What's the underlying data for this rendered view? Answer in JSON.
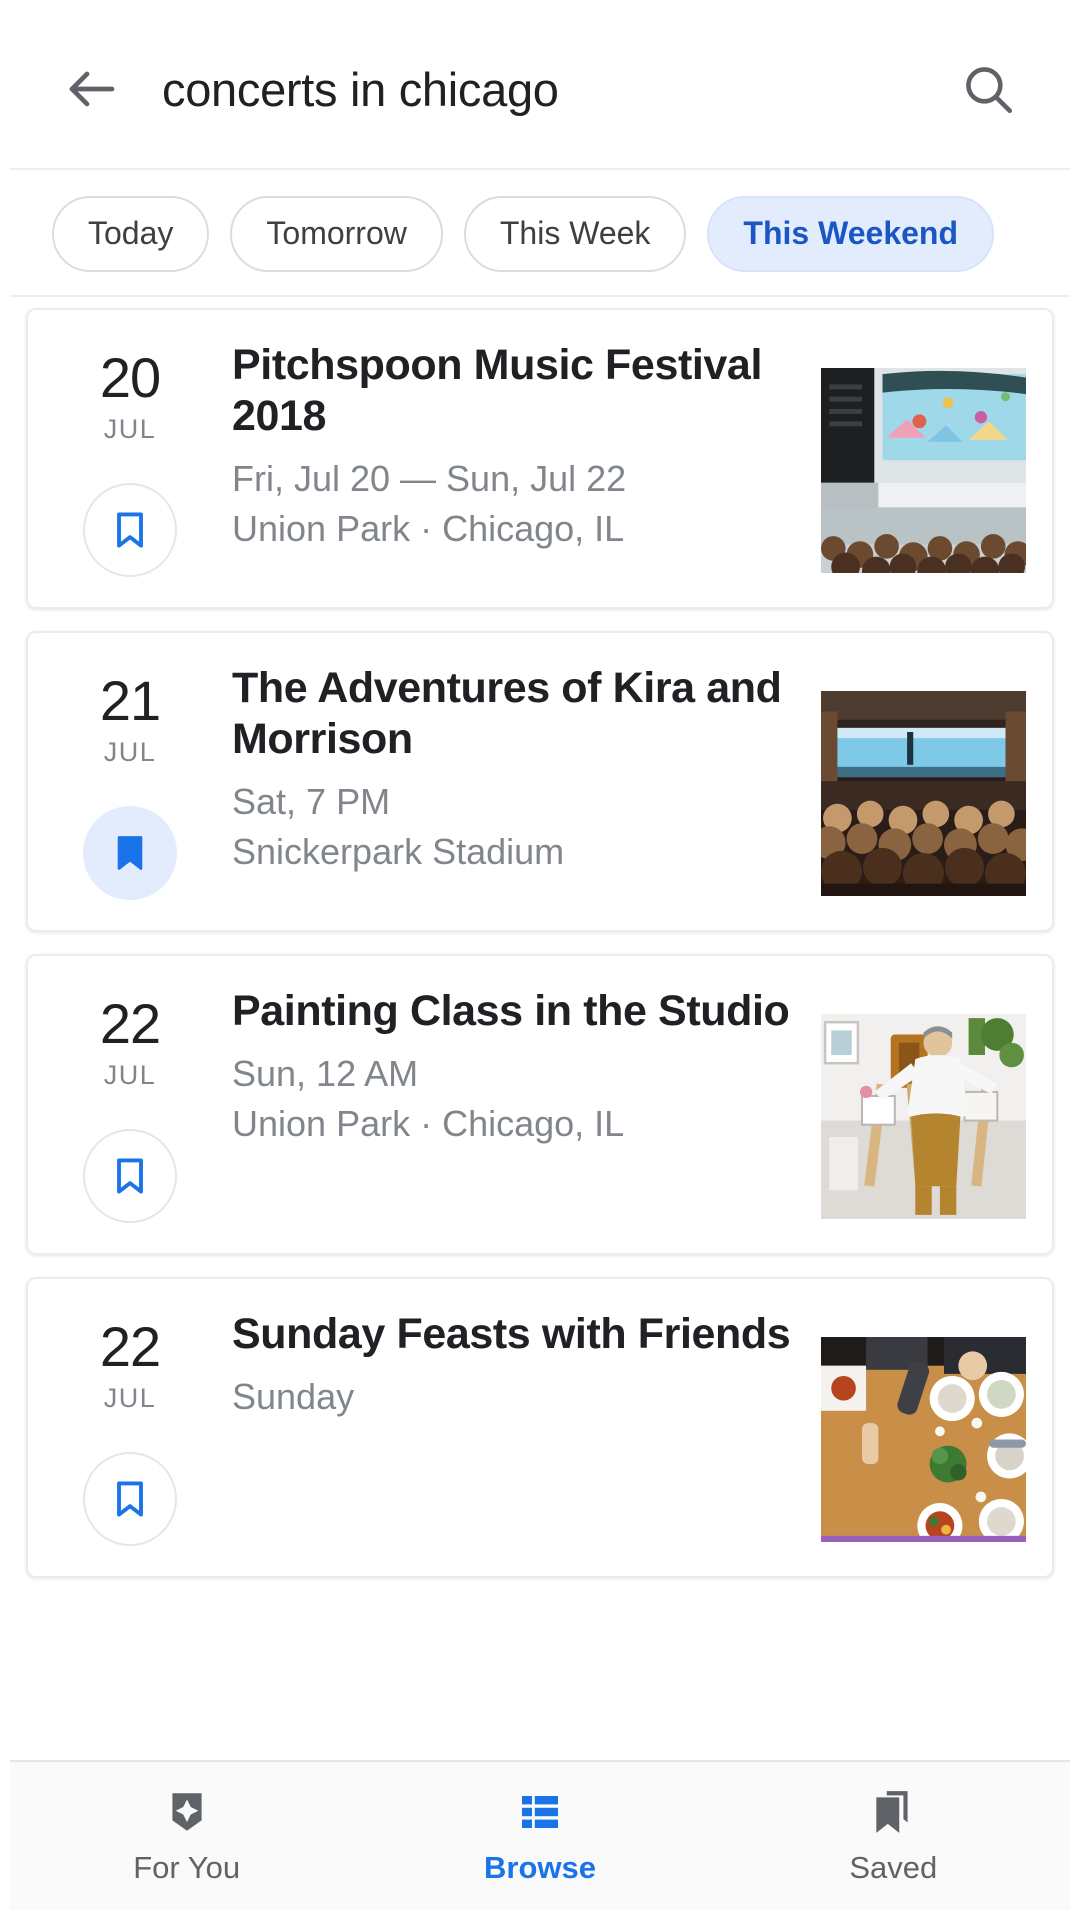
{
  "search": {
    "query": "concerts in chicago",
    "back_icon": "arrow-back-icon",
    "search_icon": "search-icon"
  },
  "filters": {
    "chips": [
      {
        "label": "Today",
        "selected": false
      },
      {
        "label": "Tomorrow",
        "selected": false
      },
      {
        "label": "This Week",
        "selected": false
      },
      {
        "label": "This Weekend",
        "selected": true
      }
    ]
  },
  "events": [
    {
      "day": "20",
      "month": "JUL",
      "title": "Pitchspoon Music Festival 2018",
      "when": "Fri, Jul 20 — Sun, Jul 22",
      "where": "Union Park · Chicago, IL",
      "saved": false,
      "bookmark_icon": "bookmark-outline-icon",
      "thumb_alt": "outdoor-music-festival-crowd-stage"
    },
    {
      "day": "21",
      "month": "JUL",
      "title": "The Adventures of Kira and Morrison",
      "when": "Sat, 7 PM",
      "where": "Snickerpark Stadium",
      "saved": true,
      "bookmark_icon": "bookmark-filled-icon",
      "thumb_alt": "indoor-theater-audience-stage"
    },
    {
      "day": "22",
      "month": "JUL",
      "title": "Painting Class in the Studio",
      "when": "Sun, 12 AM",
      "where": "Union Park · Chicago, IL",
      "saved": false,
      "bookmark_icon": "bookmark-outline-icon",
      "thumb_alt": "art-studio-painter-easels"
    },
    {
      "day": "22",
      "month": "JUL",
      "title": "Sunday Feasts with Friends",
      "when": "Sunday",
      "where": "",
      "saved": false,
      "bookmark_icon": "bookmark-outline-icon",
      "thumb_alt": "overhead-dinner-table-food"
    }
  ],
  "bottom_nav": {
    "items": [
      {
        "label": "For You",
        "icon": "sparkle-tag-icon",
        "active": false
      },
      {
        "label": "Browse",
        "icon": "list-icon",
        "active": true
      },
      {
        "label": "Saved",
        "icon": "bookmarks-icon",
        "active": false
      }
    ]
  },
  "colors": {
    "accent": "#1a73e8",
    "chip_selected_bg": "#e3ecfd",
    "chip_selected_text": "#1a56c4",
    "primary_text": "#202124",
    "secondary_text": "#80868b"
  }
}
